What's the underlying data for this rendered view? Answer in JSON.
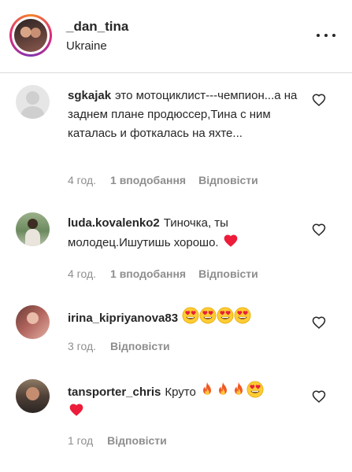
{
  "header": {
    "username": "_dan_tina",
    "location": "Ukraine"
  },
  "comments": [
    {
      "username": "sgkajak",
      "text": "это мотоциклист---чемпион...а на заднем плане продюссер,Тина с ним каталась и фоткалась на яхте...",
      "time": "4 год.",
      "likes": "1 вподобання",
      "reply": "Відповісти"
    },
    {
      "username": "luda.kovalenko2",
      "text": "Тиночка, ты молодец.Ишутишь хорошо.",
      "emojis": [
        "red-heart"
      ],
      "time": "4 год.",
      "likes": "1 вподобання",
      "reply": "Відповісти"
    },
    {
      "username": "irina_kipriyanova83",
      "text": "",
      "emojis": [
        "heart-eyes",
        "heart-eyes",
        "heart-eyes",
        "heart-eyes"
      ],
      "time": "3 год.",
      "reply": "Відповісти"
    },
    {
      "username": "tansporter_chris",
      "text": "Круто",
      "emojis": [
        "fire",
        "fire",
        "fire",
        "heart-eyes",
        "red-heart"
      ],
      "time": "1 год",
      "reply": "Відповісти"
    }
  ],
  "colors": {
    "text": "#262626",
    "meta": "#8e8e8e",
    "divider": "#dbdbdb",
    "heart_red": "#ed1c3a"
  }
}
